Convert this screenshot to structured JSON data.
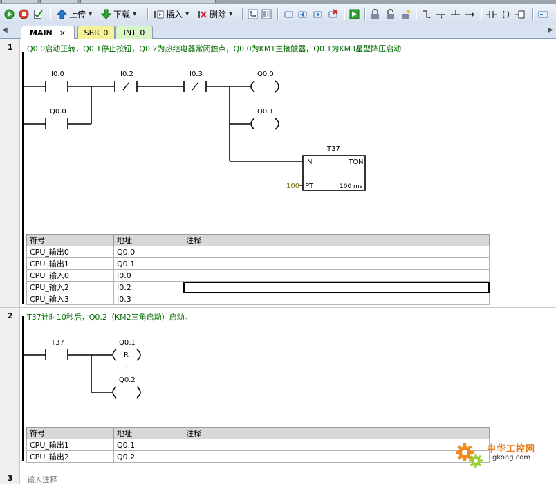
{
  "toolbar": {
    "upload_label": "上传",
    "download_label": "下载",
    "insert_label": "插入",
    "delete_label": "删除"
  },
  "tabs": {
    "main": "MAIN",
    "sbr": "SBR_0",
    "int": "INT_0",
    "close": "×"
  },
  "network1": {
    "number": "1",
    "comment": "Q0.0启动正转，Q0.1停止按钮，Q0.2为热继电器常闭触点，Q0.0为KM1主接触器，Q0.1为KM3星型降压启动",
    "contacts": {
      "i00": "I0.0",
      "i02": "I0.2",
      "i03": "I0.3",
      "q00c": "Q0.0"
    },
    "coils": {
      "q00": "Q0.0",
      "q01": "Q0.1"
    },
    "timer": {
      "name": "T37",
      "in": "IN",
      "ton": "TON",
      "pt": "PT",
      "preset": "100",
      "base": "100 ms"
    },
    "symbols": {
      "headers": [
        "符号",
        "地址",
        "注释"
      ],
      "rows": [
        [
          "CPU_输出0",
          "Q0.0",
          ""
        ],
        [
          "CPU_输出1",
          "Q0.1",
          ""
        ],
        [
          "CPU_输入0",
          "I0.0",
          ""
        ],
        [
          "CPU_输入2",
          "I0.2",
          ""
        ],
        [
          "CPU_输入3",
          "I0.3",
          ""
        ]
      ]
    }
  },
  "network2": {
    "number": "2",
    "comment": "T37计时10秒后，Q0.2（KM2三角启动）启动。",
    "contact": "T37",
    "coil_reset": {
      "name": "Q0.1",
      "type": "R",
      "count": "1"
    },
    "coil_q02": "Q0.2",
    "symbols": {
      "headers": [
        "符号",
        "地址",
        "注释"
      ],
      "rows": [
        [
          "CPU_输出1",
          "Q0.1",
          ""
        ],
        [
          "CPU_输出2",
          "Q0.2",
          ""
        ]
      ]
    }
  },
  "network3": {
    "number": "3",
    "comment": "输入注释"
  },
  "watermark": {
    "brand": "中华工控网",
    "url": "gkong.com"
  }
}
